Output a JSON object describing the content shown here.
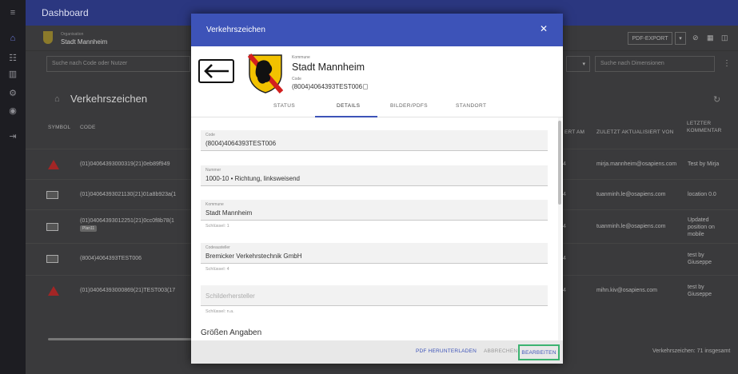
{
  "topbar": {
    "title": "Dashboard"
  },
  "org": {
    "label": "Organisation",
    "name": "Stadt Mannheim"
  },
  "toolbar": {
    "pdf_export": "PDF-EXPORT"
  },
  "filters": {
    "search_placeholder": "Suche nach Code oder Nutzer",
    "dimension_placeholder": "Suche nach Dimensionen"
  },
  "page": {
    "title": "Verkehrszeichen"
  },
  "table": {
    "headers": {
      "symbol": "SYMBOL",
      "code": "CODE",
      "updated_at": "ERT AM",
      "updated_by": "ZULETZT AKTUALISIERT VON",
      "last_comment": "LETZTER KOMMENTAR"
    },
    "rows": [
      {
        "code": "(01)04064393000319(21)0eb89f949",
        "tag": "",
        "user": "mirja.mannheim@osapiens.com",
        "comment": "Test by Mirja",
        "updated": "4"
      },
      {
        "code": "(01)04064393021130(21)01a8b923a(1",
        "tag": "",
        "user": "tuanminh.le@osapiens.com",
        "comment": "location 0.0",
        "updated": "4"
      },
      {
        "code": "(01)04064393012251(21)0cc0f8b78(1",
        "tag": "Plan11",
        "user": "tuanminh.le@osapiens.com",
        "comment": "Updated position on mobile",
        "updated": "4"
      },
      {
        "code": "(8004)4064393TEST006",
        "tag": "",
        "user": "",
        "comment": "test by Giuseppe",
        "updated": "4"
      },
      {
        "code": "(01)04064393000869(21)TEST003(17",
        "tag": "",
        "user": "mihn.kiv@osapiens.com",
        "comment": "test by Giuseppe",
        "updated": "4"
      }
    ],
    "count_text": "Verkehrszeichen: 71 insgesamt"
  },
  "modal": {
    "title": "Verkehrszeichen",
    "kommune_label": "Kommune",
    "kommune_name": "Stadt Mannheim",
    "code_label": "Code",
    "code_value": "(8004)4064393TEST006",
    "tabs": [
      "STATUS",
      "DETAILS",
      "BILDER/PDFS",
      "STANDORT"
    ],
    "active_tab": "DETAILS",
    "fields": [
      {
        "label": "Code",
        "value": "(8004)4064393TEST006",
        "help": ""
      },
      {
        "label": "Nummer",
        "value": "1000-10 • Richtung, linksweisend",
        "help": ""
      },
      {
        "label": "Kommune",
        "value": "Stadt Mannheim",
        "help": "Schlüssel: 1"
      },
      {
        "label": "Codeausteller",
        "value": "Bremicker Verkehrstechnik GmbH",
        "help": "Schlüssel: 4"
      },
      {
        "label": "",
        "placeholder": "Schilderhersteller",
        "help": "Schlüssel: n.a."
      }
    ],
    "section_title": "Größen Angaben",
    "footer": {
      "pdf": "PDF HERUNTERLADEN",
      "cancel": "ABBRECHEN",
      "edit": "BEARBEITEN"
    }
  },
  "colors": {
    "header_blue": "#3d53b8",
    "topbar_blue": "#2b3780",
    "highlight_green": "#3cb371",
    "warning_red": "#a32525"
  }
}
